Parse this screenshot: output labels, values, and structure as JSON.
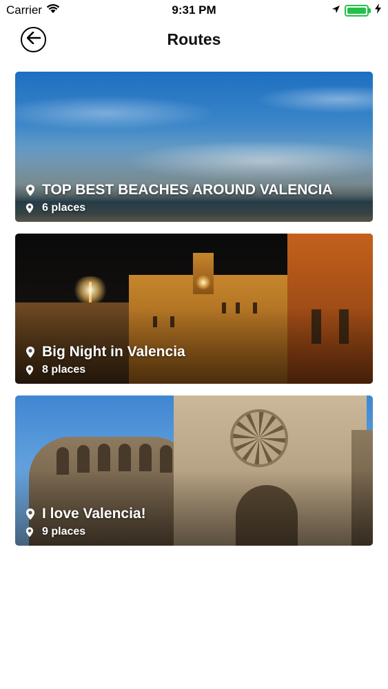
{
  "status_bar": {
    "carrier": "Carrier",
    "time": "9:31 PM"
  },
  "nav": {
    "title": "Routes"
  },
  "routes": [
    {
      "title": "TOP BEST BEACHES AROUND VALENCIA",
      "count": "6 places"
    },
    {
      "title": "Big Night in Valencia",
      "count": "8 places"
    },
    {
      "title": "I love Valencia!",
      "count": "9 places"
    }
  ],
  "colors": {
    "battery": "#24c148",
    "text_on_image": "#ffffff"
  },
  "icons": [
    "wifi-icon",
    "location-arrow-icon",
    "battery-icon",
    "charging-bolt-icon",
    "back-arrow-icon",
    "map-pin-icon"
  ]
}
